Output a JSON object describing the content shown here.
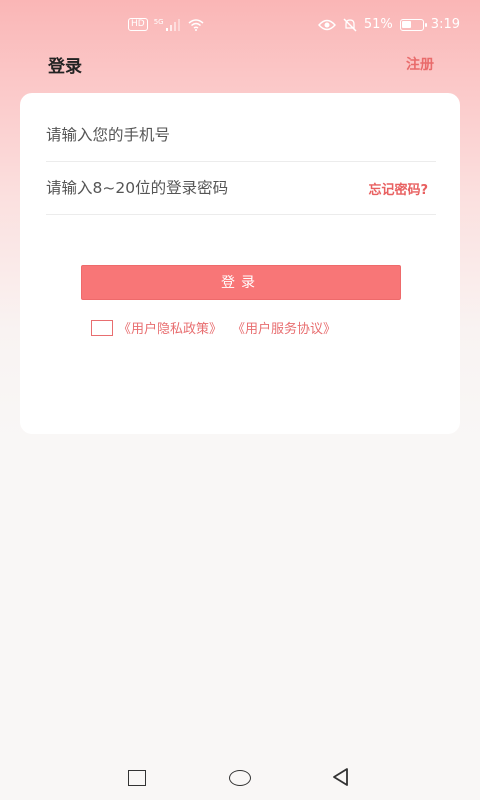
{
  "status_bar": {
    "hd_badge": "HD",
    "network_type": "5G",
    "battery_percent": "51%",
    "battery_level": 0.51,
    "time": "3:19",
    "icons": [
      "hd-icon",
      "signal-icon",
      "wifi-icon",
      "eye-icon",
      "mute-bell-icon",
      "battery-icon"
    ]
  },
  "header": {
    "title": "登录",
    "register_label": "注册"
  },
  "form": {
    "phone_placeholder": "请输入您的手机号",
    "phone_value": "",
    "password_placeholder": "请输入8~20位的登录密码",
    "password_value": "",
    "forgot_label": "忘记密码?",
    "login_label": "登录",
    "agreement_checked": false,
    "privacy_link": "《用户隐私政策》",
    "service_link": "《用户服务协议》"
  },
  "nav_bar": {
    "icons": [
      "recent-apps-icon",
      "home-icon",
      "back-icon"
    ]
  },
  "colors": {
    "accent": "#f87677",
    "link": "#e86e70",
    "gradient_top": "#fab6b6",
    "background": "#f9f7f6"
  }
}
